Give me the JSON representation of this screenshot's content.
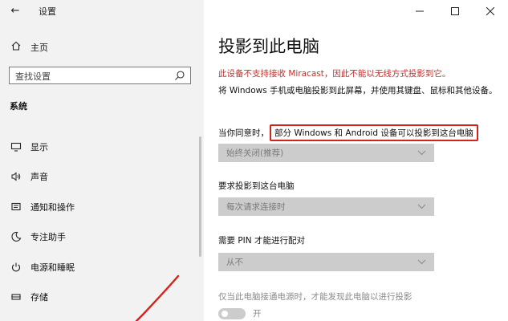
{
  "window": {
    "app_title": "设置",
    "controls": [
      "minimize-icon",
      "maximize-icon",
      "close-icon"
    ]
  },
  "sidebar": {
    "home_label": "主页",
    "search_placeholder": "查找设置",
    "section_label": "系统",
    "items": [
      {
        "label": "显示",
        "icon": "display-icon"
      },
      {
        "label": "声音",
        "icon": "sound-icon"
      },
      {
        "label": "通知和操作",
        "icon": "notifications-icon"
      },
      {
        "label": "专注助手",
        "icon": "focus-assist-icon"
      },
      {
        "label": "电源和睡眠",
        "icon": "power-icon"
      },
      {
        "label": "存储",
        "icon": "storage-icon"
      }
    ]
  },
  "main": {
    "title": "投影到此电脑",
    "warning": "此设备不支持接收 Miracast，因此不能以无线方式投影到它。",
    "description": "将 Windows 手机或电脑投影到此屏幕，并使用其键盘、鼠标和其他设备。",
    "question_prefix": "当你同意时，",
    "question_highlight": "部分 Windows 和 Android 设备可以投影到这台电脑",
    "dropdown1_value": "始终关闭(推荐)",
    "label2": "要求投影到这台电脑",
    "dropdown2_value": "每次请求连接时",
    "label3": "需要 PIN 才能进行配对",
    "dropdown3_value": "从不",
    "hint": "仅当此电脑接通电源时，才能发现此电脑以进行投影",
    "toggle_label": "开",
    "toggle_on": true
  },
  "colors": {
    "warning": "#c0302e",
    "highlight_border": "#d0241c",
    "sidebar_bg": "#f2f2f2",
    "disabled_dropdown": "#cccccc",
    "annotation": "#d0241c"
  }
}
